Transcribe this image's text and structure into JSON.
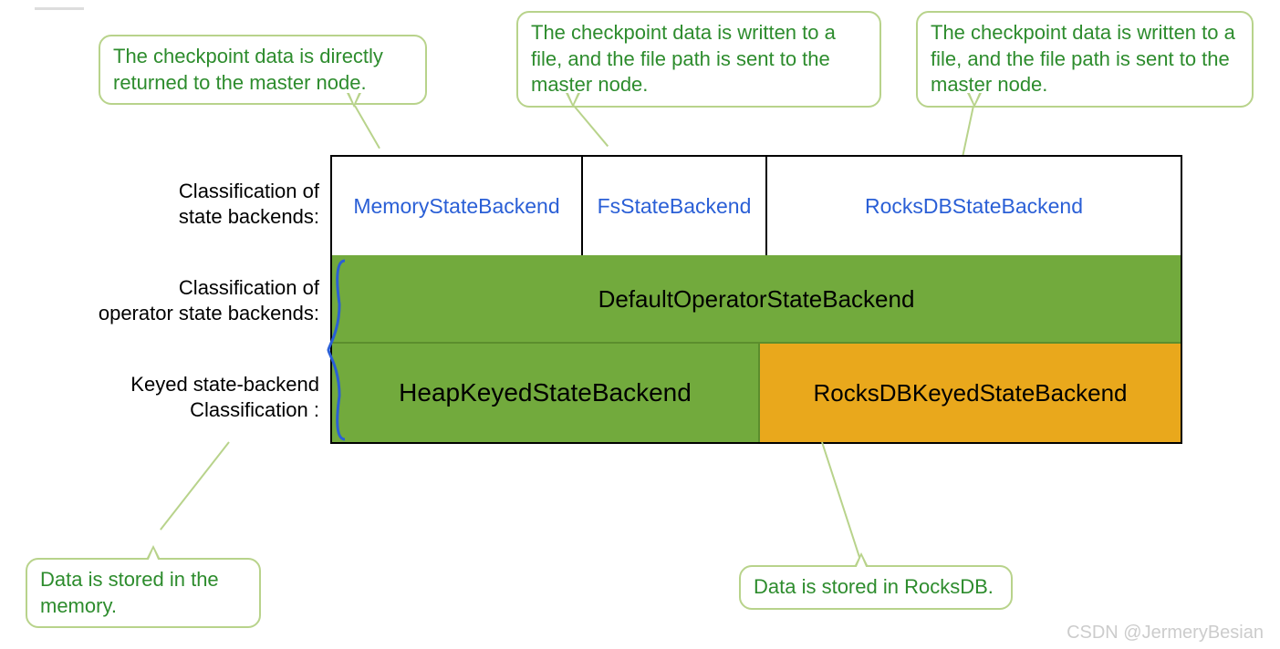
{
  "callouts": {
    "c1": "The checkpoint data is directly returned to the master node.",
    "c2": "The checkpoint data is written to a file, and the file path is sent to the master node.",
    "c3": "The checkpoint data is written to a file, and the file path is sent to the master node.",
    "c4": "Data is stored in the memory.",
    "c5": "Data is stored in RocksDB."
  },
  "labels": {
    "state_backends_l1": "Classification of",
    "state_backends_l2": "state backends:",
    "op_backends_l1": "Classification of",
    "op_backends_l2": "operator state backends:",
    "keyed_l1": "Keyed state-backend",
    "keyed_l2": "Classification :"
  },
  "cells": {
    "memory": "MemoryStateBackend",
    "fs": "FsStateBackend",
    "rocks": "RocksDBStateBackend",
    "default_op": "DefaultOperatorStateBackend",
    "heap_keyed": "HeapKeyedStateBackend",
    "rocks_keyed": "RocksDBKeyedStateBackend"
  },
  "watermark": "CSDN @JermeryBesian"
}
